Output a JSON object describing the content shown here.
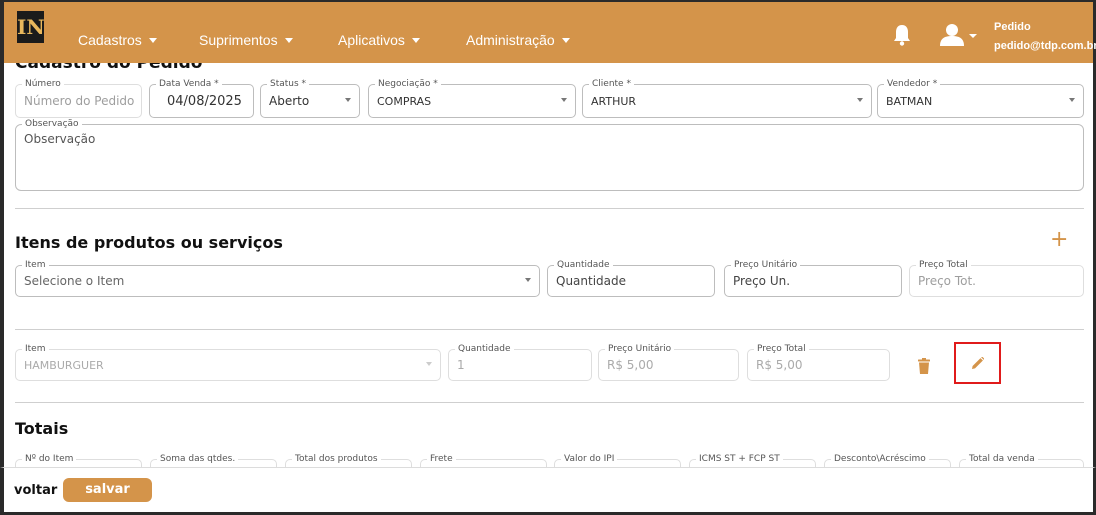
{
  "brand": {
    "logo_text": "IN"
  },
  "nav": {
    "items": [
      {
        "label": "Cadastros"
      },
      {
        "label": "Suprimentos"
      },
      {
        "label": "Aplicativos"
      },
      {
        "label": "Administração"
      }
    ],
    "icons": {
      "notifications": "bell-icon",
      "user": "user-icon"
    },
    "user": {
      "name": "Pedido",
      "email": "pedido@tdp.com.br"
    }
  },
  "page": {
    "title": "Cadastro do Pedido"
  },
  "order": {
    "numero": {
      "label": "Número",
      "placeholder": "Número do Pedido"
    },
    "data_venda": {
      "label": "Data Venda *",
      "value": "04/08/2025"
    },
    "status": {
      "label": "Status *",
      "value": "Aberto"
    },
    "negociacao": {
      "label": "Negociação *",
      "value": "COMPRAS"
    },
    "cliente": {
      "label": "Cliente *",
      "value": "ARTHUR"
    },
    "vendedor": {
      "label": "Vendedor *",
      "value": "BATMAN"
    },
    "observacao": {
      "label": "Observação",
      "placeholder": "Observação"
    }
  },
  "items_section": {
    "title": "Itens de produtos ou serviços",
    "new_item": {
      "item": {
        "label": "Item",
        "placeholder": "Selecione o Item"
      },
      "quantidade": {
        "label": "Quantidade",
        "placeholder": "Quantidade"
      },
      "preco_unitario": {
        "label": "Preço Unitário",
        "placeholder": "Preço Un."
      },
      "preco_total": {
        "label": "Preço Total",
        "placeholder": "Preço Tot."
      }
    },
    "rows": [
      {
        "item": {
          "label": "Item",
          "value": "HAMBURGUER"
        },
        "quantidade": {
          "label": "Quantidade",
          "value": "1"
        },
        "preco_unitario": {
          "label": "Preço Unitário",
          "value": "R$ 5,00"
        },
        "preco_total": {
          "label": "Preço Total",
          "value": "R$ 5,00"
        }
      }
    ]
  },
  "totals": {
    "title": "Totais",
    "fields": [
      {
        "label": "Nº do Item"
      },
      {
        "label": "Soma das qtdes."
      },
      {
        "label": "Total dos produtos"
      },
      {
        "label": "Frete"
      },
      {
        "label": "Valor do IPI"
      },
      {
        "label": "ICMS ST + FCP ST"
      },
      {
        "label": "Desconto\\Acréscimo"
      },
      {
        "label": "Total da venda"
      }
    ]
  },
  "footer": {
    "back_label": "voltar",
    "save_label": "salvar"
  },
  "colors": {
    "accent": "#d4944a",
    "highlight": "#e01b1b"
  }
}
